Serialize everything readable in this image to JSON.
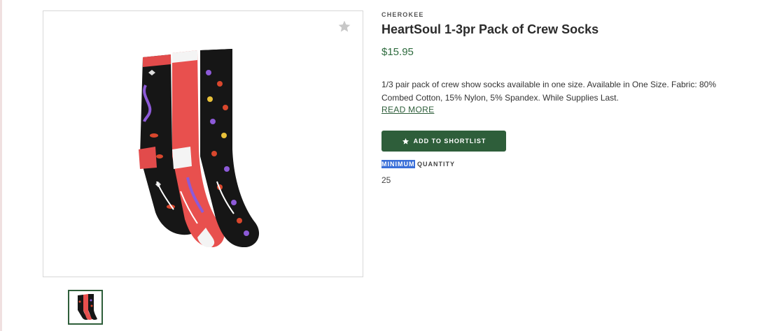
{
  "product": {
    "brand": "CHEROKEE",
    "title": "HeartSoul 1-3pr Pack of Crew Socks",
    "price": "$15.95",
    "description": "1/3 pair pack of crew show socks available in one size. Available in One Size. Fabric: 80% Combed Cotton, 15% Nylon, 5% Spandex. While Supplies Last.",
    "read_more_label": "READ MORE",
    "shortlist_label": "ADD TO SHORTLIST",
    "quantity_label_highlight": "MINIMUM",
    "quantity_label_rest": " QUANTITY",
    "minimum_quantity": "25"
  },
  "gallery": {
    "favorite_icon": "star-icon",
    "thumbnails": [
      {
        "selected": true
      }
    ]
  },
  "colors": {
    "accent": "#2e5e3a",
    "price": "#2e6b3e",
    "highlight": "#3a6fd8"
  }
}
